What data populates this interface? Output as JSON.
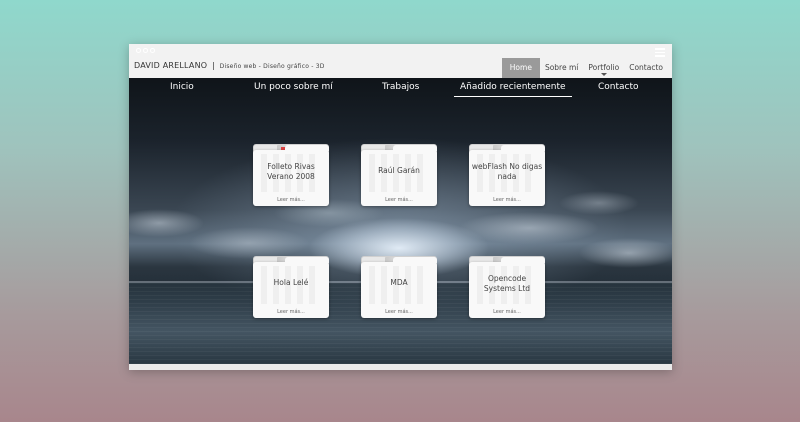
{
  "window": {
    "brand_name": "DAVID ARELLANO",
    "brand_separator": "|",
    "brand_tagline": "Diseño web - Diseño gráfico - 3D"
  },
  "top_nav": [
    {
      "label": "Home",
      "active": true
    },
    {
      "label": "Sobre mí",
      "active": false
    },
    {
      "label": "Portfolio",
      "active": false
    },
    {
      "label": "Contacto",
      "active": false
    }
  ],
  "main_nav": [
    {
      "label": "Inicio",
      "active": false
    },
    {
      "label": "Un poco sobre mí",
      "active": false
    },
    {
      "label": "Trabajos",
      "active": false
    },
    {
      "label": "Añadido recientemente",
      "active": true
    },
    {
      "label": "Contacto",
      "active": false
    }
  ],
  "folders": [
    {
      "title": "Folleto Rivas Verano 2008",
      "more": "Leer más..."
    },
    {
      "title": "Raúl Garán",
      "more": "Leer más..."
    },
    {
      "title": "webFlash No digas nada",
      "more": "Leer más..."
    },
    {
      "title": "Hola Lelé",
      "more": "Leer más..."
    },
    {
      "title": "MDA",
      "more": "Leer más..."
    },
    {
      "title": "Opencode Systems Ltd",
      "more": "Leer más..."
    }
  ],
  "colors": {
    "accent_active": "#9a9a9a",
    "text_dark": "#333333",
    "nav_text": "#ffffff"
  },
  "icons": [
    "window-dots-icon",
    "hamburger-menu-icon",
    "dropdown-caret-icon",
    "folder-icon"
  ]
}
